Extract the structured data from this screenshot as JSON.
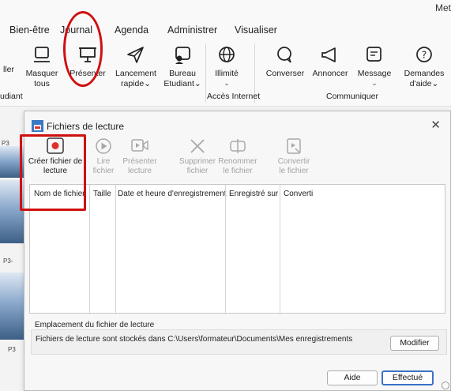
{
  "window": {
    "corner_text": "Met"
  },
  "ribbon": {
    "tabs": [
      "Bien-être",
      "Journal",
      "Agenda",
      "Administrer",
      "Visualiser"
    ],
    "buttons": {
      "masquer": {
        "line1": "Masquer",
        "line2": "tous"
      },
      "presenter": {
        "line1": "Présenter",
        "chevron": "⌄"
      },
      "lancement": {
        "line1": "Lancement",
        "line2": "rapide⌄"
      },
      "bureau": {
        "line1": "Bureau",
        "line2": "Etudiant⌄"
      },
      "illimite": {
        "line1": "Illimité",
        "chevron": "⌄"
      },
      "converser": {
        "line1": "Converser"
      },
      "annoncer": {
        "line1": "Annoncer"
      },
      "message": {
        "line1": "Message",
        "chevron": "⌄"
      },
      "demandes": {
        "line1": "Demandes",
        "line2": "d'aide⌄"
      }
    },
    "left_cut_button": "ller",
    "groups": {
      "left": "udiant",
      "internet": "Accès Internet",
      "communiquer": "Communiquer"
    }
  },
  "background": {
    "thumb_labels": [
      "P3",
      "P3-",
      "P3"
    ]
  },
  "dialog": {
    "title": "Fichiers de lecture",
    "close": "✕",
    "toolbar": {
      "creer": {
        "line1": "Créer fichier de",
        "line2": "lecture"
      },
      "lire": {
        "line1": "Lire",
        "line2": "fichier"
      },
      "presenter": {
        "line1": "Présenter",
        "line2": "lecture"
      },
      "supprimer": {
        "line1": "Supprimer",
        "line2": "fichier"
      },
      "renommer": {
        "line1": "Renommer",
        "line2": "le fichier"
      },
      "convertir": {
        "line1": "Convertir",
        "line2": "le fichier"
      }
    },
    "columns": [
      "Nom de fichier",
      "Taille",
      "Date et heure d'enregistrement",
      "Enregistré sur",
      "Converti"
    ],
    "location": {
      "label": "Emplacement du fichier de lecture",
      "text": "Fichiers de lecture sont stockés dans C:\\Users\\formateur\\Documents\\Mes enregistrements"
    },
    "buttons": {
      "modifier": "Modifier",
      "aide": "Aide",
      "effectue": "Effectué"
    }
  },
  "colors": {
    "annotation_red": "#d01010",
    "record_red": "#e0302a",
    "accent_blue": "#3a72c6",
    "green_line": "#2ea44f"
  }
}
